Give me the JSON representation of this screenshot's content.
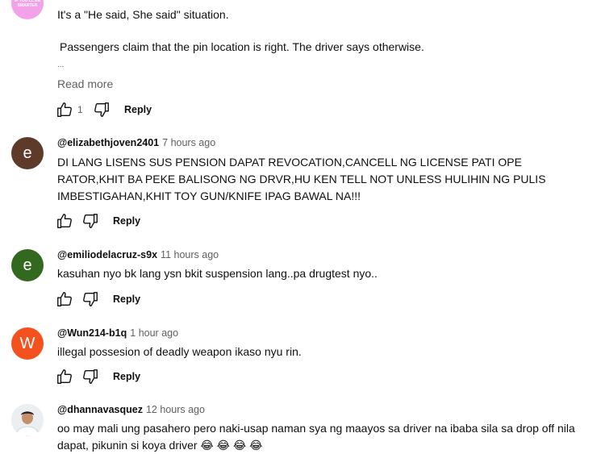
{
  "comments": [
    {
      "avatar_text": "IF YOU'LL BE SMARTER",
      "avatar_color": "#f3a2ea",
      "line1": "It's a \"He said, She said\" situation.",
      "line2": "Passengers claim that the pin location is right. The driver says otherwise.",
      "ellipsis": "...",
      "read_more": "Read more",
      "likes": "1",
      "reply_label": "Reply"
    },
    {
      "author": "@elizabethjoven2401",
      "time": "7 hours ago",
      "avatar_letter": "e",
      "avatar_color": "#5e3a2a",
      "text": "DI LANG LISENS SUS PENSION DAPAT REVOCATION,CANCELL NG LICENSE PATI OPE RATOR,KHIT BA PEKE BALISONG NG DRVR,HU KEN TELL  NOT UNLESS HULIHIN NG PULIS IMBESTIGAHAN,KHIT TOY GUN/KNIFE  IPAG BAWAL NA!!!",
      "reply_label": "Reply"
    },
    {
      "author": "@emiliodelacruz-s9x",
      "time": "11 hours ago",
      "avatar_letter": "e",
      "avatar_color": "#33691e",
      "text": "kasuhan nyo bk lang  ysn bkit suspension lang..pa drugtest nyo..",
      "reply_label": "Reply"
    },
    {
      "author": "@Wun214-b1q",
      "time": "1 hour ago",
      "avatar_letter": "W",
      "avatar_color": "#f4511e",
      "text": "illegal possesion of deadly weapon ikaso nyu rin.",
      "reply_label": "Reply"
    },
    {
      "author": "@dhannavasquez",
      "time": "12 hours ago",
      "text": "oo may mali ung pasahero pero naki-usap naman sya ng maayos sa driver na ibaba sila sa drop off nila dapat, pikunin si koya driver 😂 😂 😂 😂"
    }
  ]
}
